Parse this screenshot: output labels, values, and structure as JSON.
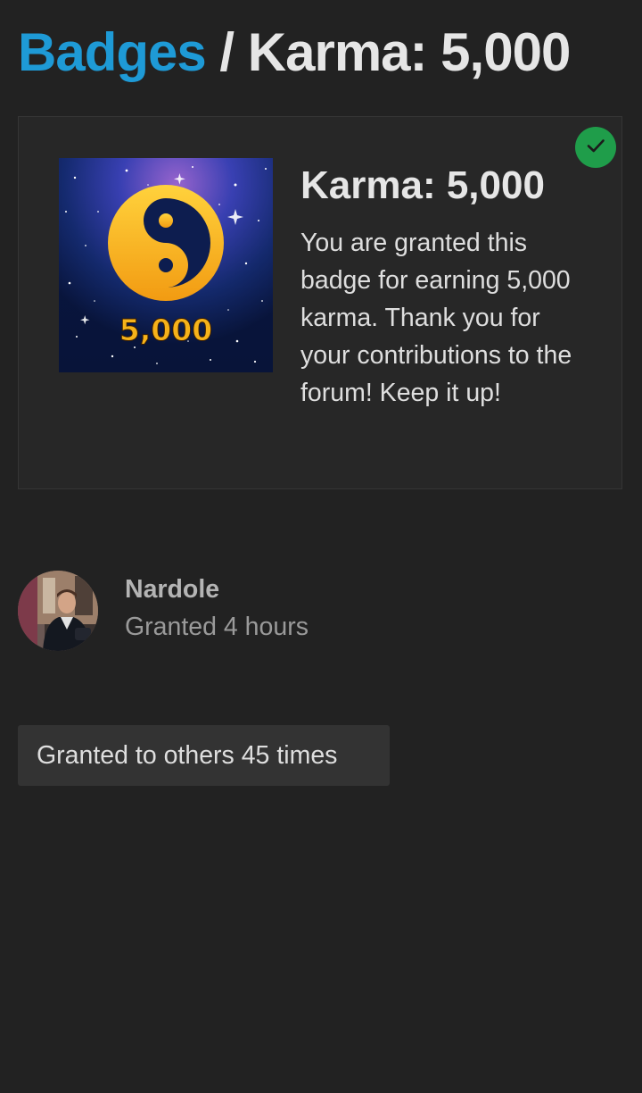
{
  "header": {
    "breadcrumb_link": "Badges",
    "separator": "/",
    "current": "Karma: 5,000",
    "link_color": "#1E9AD6"
  },
  "badge": {
    "name": "Karma: 5,000",
    "description": "You are granted this badge for earning 5,000 karma. Thank you for your contributions to the forum! Keep it up!",
    "image_text": "5,000",
    "image_icon": "yin-yang-icon",
    "granted": true,
    "granted_icon": "check-icon",
    "granted_color": "#1F9D4A"
  },
  "grant": {
    "user_name": "Nardole",
    "time_text": "Granted 4 hours"
  },
  "others": {
    "button_label": "Granted to others 45 times"
  },
  "colors": {
    "background": "#222222",
    "card": "#272727",
    "button": "#333333",
    "badge_gold": "#F6B21A"
  }
}
